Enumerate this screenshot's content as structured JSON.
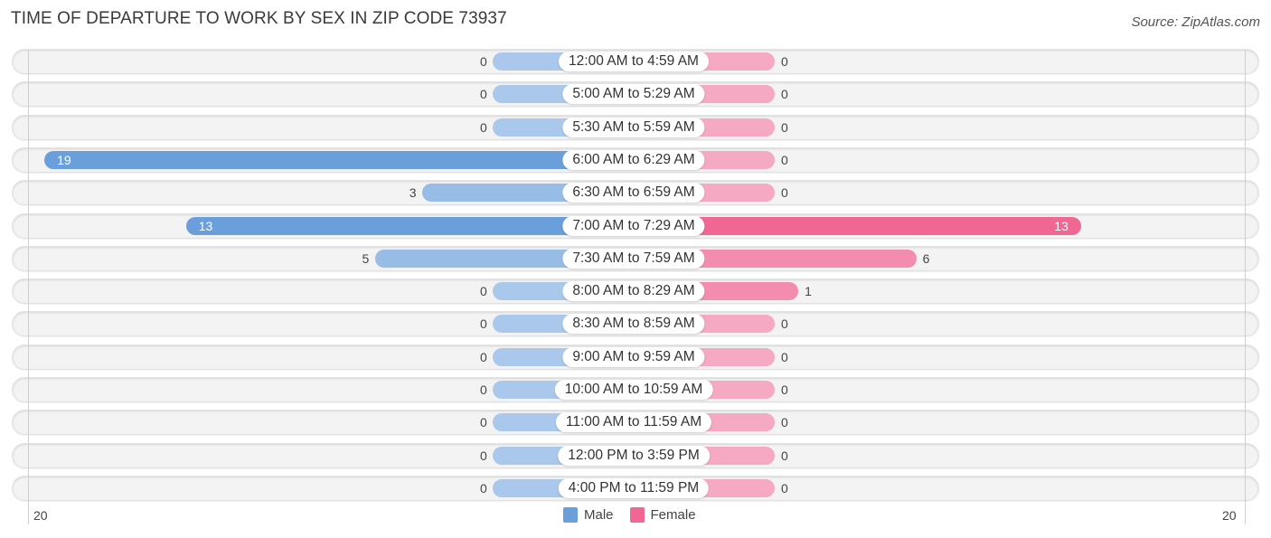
{
  "header": {
    "title": "TIME OF DEPARTURE TO WORK BY SEX IN ZIP CODE 73937",
    "source": "Source: ZipAtlas.com"
  },
  "colors": {
    "male": "#6a9fdc",
    "male_light": "#a9c8eb",
    "female": "#f06793",
    "female_light": "#f6a9c2"
  },
  "axis": {
    "left_label": "20",
    "right_label": "20"
  },
  "legend": [
    {
      "name": "Male",
      "color": "#6a9fdc"
    },
    {
      "name": "Female",
      "color": "#f06793"
    }
  ],
  "chart_data": {
    "type": "bar",
    "title": "TIME OF DEPARTURE TO WORK BY SEX IN ZIP CODE 73937",
    "orientation": "horizontal-diverging",
    "xlabel": "",
    "ylabel": "",
    "xlim": [
      -20,
      20
    ],
    "legend_position": "bottom-center",
    "categories": [
      "12:00 AM to 4:59 AM",
      "5:00 AM to 5:29 AM",
      "5:30 AM to 5:59 AM",
      "6:00 AM to 6:29 AM",
      "6:30 AM to 6:59 AM",
      "7:00 AM to 7:29 AM",
      "7:30 AM to 7:59 AM",
      "8:00 AM to 8:29 AM",
      "8:30 AM to 8:59 AM",
      "9:00 AM to 9:59 AM",
      "10:00 AM to 10:59 AM",
      "11:00 AM to 11:59 AM",
      "12:00 PM to 3:59 PM",
      "4:00 PM to 11:59 PM"
    ],
    "series": [
      {
        "name": "Male",
        "values": [
          0,
          0,
          0,
          19,
          3,
          13,
          5,
          0,
          0,
          0,
          0,
          0,
          0,
          0
        ]
      },
      {
        "name": "Female",
        "values": [
          0,
          0,
          0,
          0,
          0,
          13,
          6,
          1,
          0,
          0,
          0,
          0,
          0,
          0
        ]
      }
    ]
  }
}
